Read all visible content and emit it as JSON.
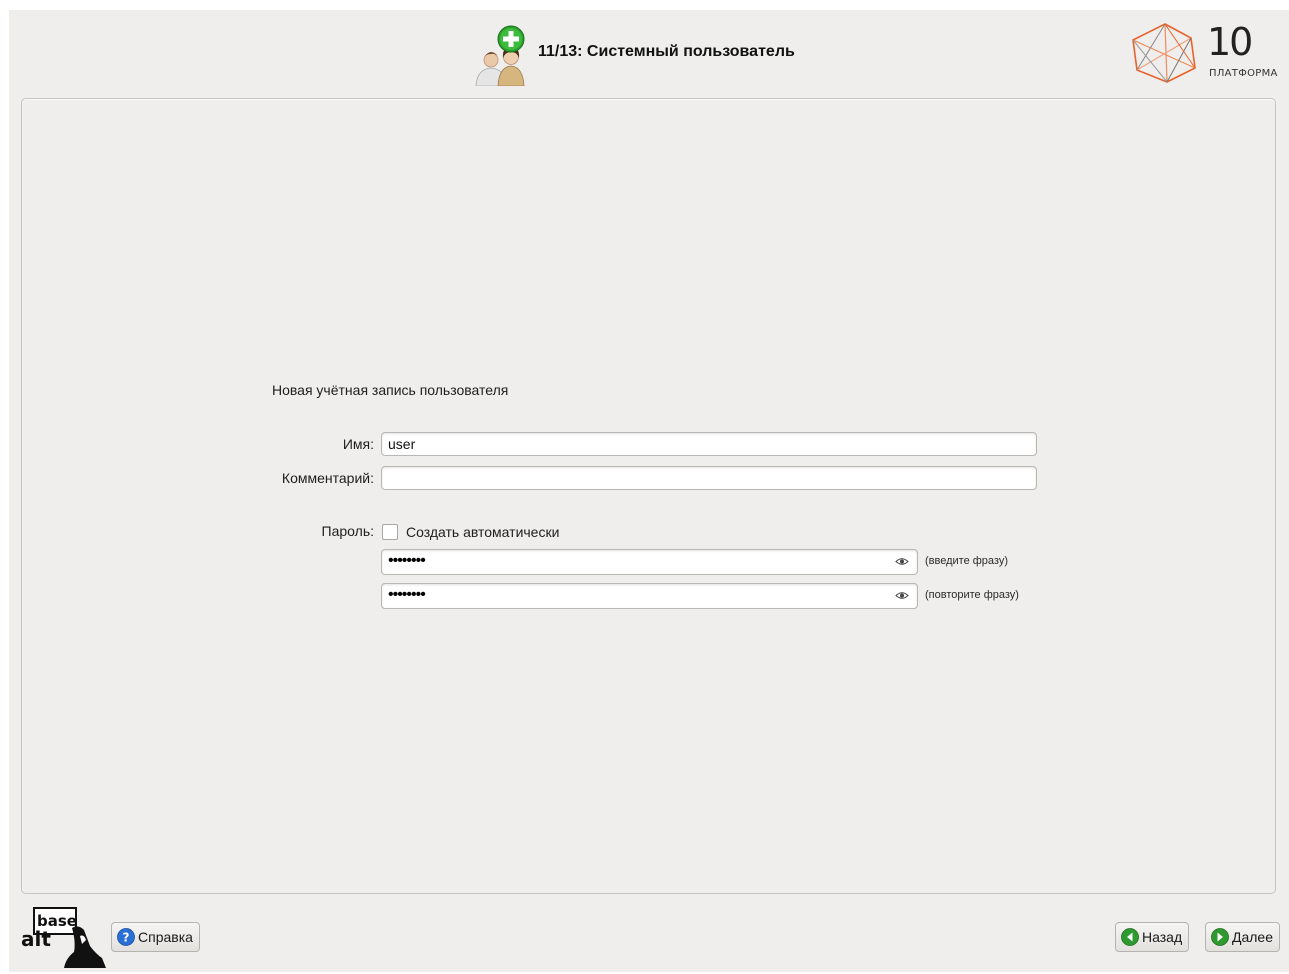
{
  "header": {
    "step_title": "11/13: Системный пользователь",
    "step_icon": "add-user-icon",
    "brand": {
      "number": "10",
      "name": "ПЛАТФОРМА"
    }
  },
  "form": {
    "heading": "Новая учётная запись пользователя",
    "name_label": "Имя:",
    "name_value": "user",
    "comment_label": "Комментарий:",
    "comment_value": "",
    "password_label": "Пароль:",
    "auto_label": "Создать автоматически",
    "auto_checked": false,
    "password_mask": "••••••••",
    "password_confirm_mask": "••••••••",
    "password_hint": "(введите фразу)",
    "password_confirm_hint": "(повторите фразу)"
  },
  "footer": {
    "logo_text_top": "base",
    "logo_text_bottom": "alt",
    "help_label": "Справка",
    "back_label": "Назад",
    "next_label": "Далее"
  },
  "colors": {
    "window_bg": "#efeeec",
    "help_icon": "#2a6fd6",
    "nav_icon": "#2f9a2f",
    "brand_orange": "#e8632b"
  }
}
